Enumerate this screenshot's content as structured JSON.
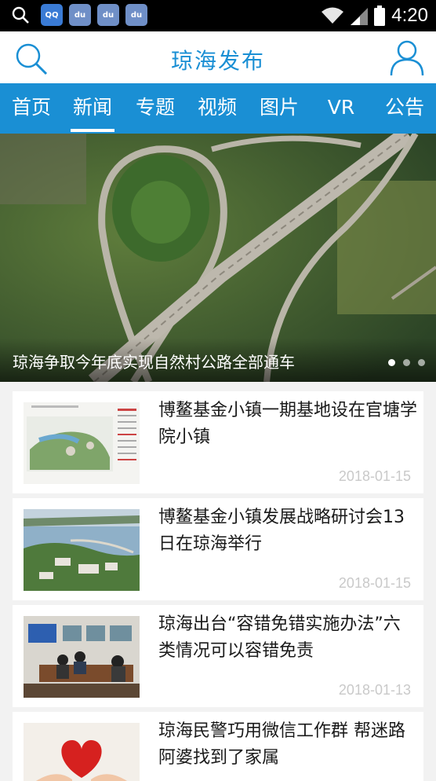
{
  "status_bar": {
    "time": "4:20",
    "notification_icons": [
      "qq-icon",
      "baidu-icon",
      "baidu-icon",
      "baidu-icon"
    ],
    "notification_labels": [
      "QQ",
      "du",
      "du",
      "du"
    ]
  },
  "header": {
    "title": "琼海发布",
    "accent_color": "#1a8fd4"
  },
  "nav": {
    "tabs": [
      {
        "label": "首页",
        "active": false
      },
      {
        "label": "新闻",
        "active": true
      },
      {
        "label": "专题",
        "active": false
      },
      {
        "label": "视频",
        "active": false
      },
      {
        "label": "图片",
        "active": false
      },
      {
        "label": "VR",
        "active": false
      },
      {
        "label": "公告",
        "active": false
      }
    ]
  },
  "banner": {
    "caption": "琼海争取今年底实现自然村公路全部通车",
    "slide_count": 3,
    "active_slide": 1
  },
  "news": [
    {
      "title": "博鳌基金小镇一期基地设在官塘学院小镇",
      "date": "2018-01-15"
    },
    {
      "title": "博鳌基金小镇发展战略研讨会13日在琼海举行",
      "date": "2018-01-15"
    },
    {
      "title": "琼海出台“容错免错实施办法”六类情况可以容错免责",
      "date": "2018-01-13"
    },
    {
      "title": "琼海民警巧用微信工作群 帮迷路阿婆找到了家属",
      "date": ""
    }
  ]
}
